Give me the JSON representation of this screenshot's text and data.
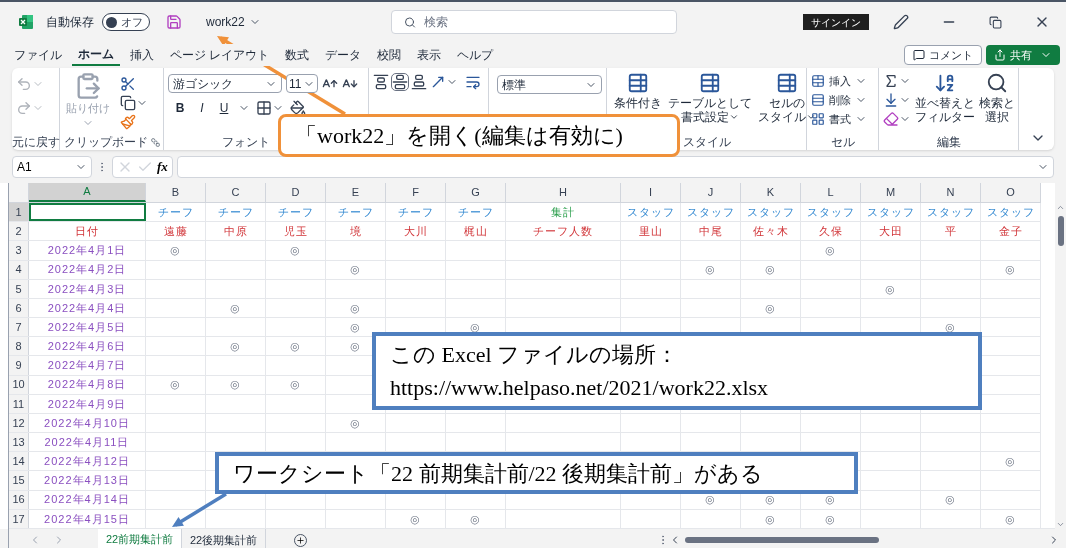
{
  "title_bar": {
    "autosave_label": "自動保存",
    "autosave_state": "オフ",
    "autosave_on": false,
    "file_name": "work22",
    "search_placeholder": "検索",
    "signin": "サインイン"
  },
  "menu_tabs": [
    {
      "label": "ファイル",
      "selected": false
    },
    {
      "label": "ホーム",
      "selected": true
    },
    {
      "label": "挿入",
      "selected": false
    },
    {
      "label": "ページ レイアウト",
      "selected": false
    },
    {
      "label": "数式",
      "selected": false
    },
    {
      "label": "データ",
      "selected": false
    },
    {
      "label": "校閲",
      "selected": false
    },
    {
      "label": "表示",
      "selected": false
    },
    {
      "label": "ヘルプ",
      "selected": false
    }
  ],
  "comment_button": "コメント",
  "share_button": "共有",
  "ribbon": {
    "undo": {
      "label": "元に戻す",
      "disabled": true
    },
    "clipboard": {
      "label": "クリップボード",
      "paste": "貼り付け",
      "paste_disabled": true
    },
    "font": {
      "label": "フォント",
      "font_name": "游ゴシック",
      "font_size": "11",
      "bold": "B",
      "italic": "I",
      "underline": "U"
    },
    "number": {
      "format": "標準"
    },
    "styles": {
      "label": "スタイル",
      "buttons": [
        {
          "lines": [
            "条件付き"
          ],
          "menu": false
        },
        {
          "lines": [
            "テーブルとして",
            "書式設定"
          ],
          "menu": true
        },
        {
          "lines": [
            "セルの",
            "スタイル"
          ],
          "menu": true
        }
      ]
    },
    "cells": {
      "label": "セル",
      "buttons": [
        {
          "kind": "insert",
          "label": "挿入"
        },
        {
          "kind": "delete",
          "label": "削除"
        },
        {
          "kind": "format",
          "label": "書式"
        }
      ]
    },
    "editing": {
      "label": "編集",
      "sort": [
        "並べ替えと",
        "フィルター"
      ],
      "find": [
        "検索と",
        "選択"
      ]
    }
  },
  "formula_bar": {
    "name_box": "A1",
    "fx": "fx"
  },
  "sheet": {
    "columns": [
      {
        "letter": "A",
        "selected": true
      },
      {
        "letter": "B",
        "selected": false
      },
      {
        "letter": "C",
        "selected": false
      },
      {
        "letter": "D",
        "selected": false
      },
      {
        "letter": "E",
        "selected": false
      },
      {
        "letter": "F",
        "selected": false
      },
      {
        "letter": "G",
        "selected": false
      },
      {
        "letter": "H",
        "selected": false
      },
      {
        "letter": "I",
        "selected": false
      },
      {
        "letter": "J",
        "selected": false
      },
      {
        "letter": "K",
        "selected": false
      },
      {
        "letter": "L",
        "selected": false
      },
      {
        "letter": "M",
        "selected": false
      },
      {
        "letter": "N",
        "selected": false
      },
      {
        "letter": "O",
        "selected": false
      }
    ],
    "rows": [
      {
        "number": "1",
        "kind": "role",
        "selected": true,
        "cells": [
          null,
          "チーフ",
          "チーフ",
          "チーフ",
          "チーフ",
          "チーフ",
          "チーフ",
          {
            "text": "集計",
            "kind": "total"
          },
          "スタッフ",
          "スタッフ",
          "スタッフ",
          "スタッフ",
          "スタッフ",
          "スタッフ",
          "スタッフ"
        ]
      },
      {
        "number": "2",
        "kind": "name",
        "selected": false,
        "cells": [
          "日付",
          "遠藤",
          "中原",
          "児玉",
          "境",
          "大川",
          "梶山",
          "チーフ人数",
          "里山",
          "中尾",
          "佐々木",
          "久保",
          "大田",
          "平",
          "金子"
        ]
      },
      {
        "number": "3",
        "kind": "entry",
        "selected": false,
        "cells": [
          "2022年4月1日",
          "◎",
          null,
          "◎",
          null,
          null,
          null,
          null,
          null,
          null,
          null,
          "◎",
          null,
          null,
          null
        ]
      },
      {
        "number": "4",
        "kind": "entry",
        "selected": false,
        "cells": [
          "2022年4月2日",
          null,
          null,
          null,
          "◎",
          null,
          null,
          null,
          null,
          "◎",
          "◎",
          null,
          null,
          null,
          "◎"
        ]
      },
      {
        "number": "5",
        "kind": "entry",
        "selected": false,
        "cells": [
          "2022年4月3日",
          null,
          null,
          null,
          null,
          null,
          null,
          null,
          null,
          null,
          null,
          null,
          "◎",
          null,
          null
        ]
      },
      {
        "number": "6",
        "kind": "entry",
        "selected": false,
        "cells": [
          "2022年4月4日",
          null,
          "◎",
          null,
          "◎",
          null,
          null,
          null,
          null,
          null,
          "◎",
          null,
          null,
          null,
          null
        ]
      },
      {
        "number": "7",
        "kind": "entry",
        "selected": false,
        "cells": [
          "2022年4月5日",
          null,
          null,
          null,
          "◎",
          null,
          "◎",
          null,
          null,
          null,
          null,
          null,
          null,
          "◎",
          null
        ]
      },
      {
        "number": "8",
        "kind": "entry",
        "selected": false,
        "cells": [
          "2022年4月6日",
          null,
          "◎",
          "◎",
          "◎",
          null,
          null,
          null,
          null,
          null,
          null,
          null,
          null,
          null,
          null
        ]
      },
      {
        "number": "9",
        "kind": "entry",
        "selected": false,
        "cells": [
          "2022年4月7日",
          null,
          null,
          null,
          null,
          null,
          null,
          null,
          null,
          null,
          null,
          null,
          null,
          null,
          null
        ]
      },
      {
        "number": "10",
        "kind": "entry",
        "selected": false,
        "cells": [
          "2022年4月8日",
          "◎",
          "◎",
          "◎",
          null,
          null,
          null,
          null,
          null,
          null,
          null,
          null,
          null,
          null,
          null
        ]
      },
      {
        "number": "11",
        "kind": "entry",
        "selected": false,
        "cells": [
          "2022年4月9日",
          null,
          null,
          null,
          null,
          null,
          null,
          null,
          null,
          null,
          null,
          null,
          null,
          null,
          null
        ]
      },
      {
        "number": "12",
        "kind": "entry",
        "selected": false,
        "cells": [
          "2022年4月10日",
          null,
          null,
          null,
          "◎",
          null,
          null,
          null,
          null,
          null,
          null,
          null,
          null,
          null,
          null
        ]
      },
      {
        "number": "13",
        "kind": "entry",
        "selected": false,
        "cells": [
          "2022年4月11日",
          null,
          null,
          null,
          null,
          null,
          null,
          null,
          null,
          null,
          null,
          null,
          null,
          null,
          null
        ]
      },
      {
        "number": "14",
        "kind": "entry",
        "selected": false,
        "cells": [
          "2022年4月12日",
          null,
          null,
          null,
          null,
          null,
          null,
          null,
          null,
          null,
          null,
          null,
          null,
          null,
          "◎"
        ]
      },
      {
        "number": "15",
        "kind": "entry",
        "selected": false,
        "cells": [
          "2022年4月13日",
          null,
          null,
          null,
          null,
          null,
          null,
          null,
          null,
          null,
          null,
          null,
          null,
          null,
          null
        ]
      },
      {
        "number": "16",
        "kind": "entry",
        "selected": false,
        "cells": [
          "2022年4月14日",
          null,
          null,
          null,
          null,
          null,
          null,
          null,
          null,
          "◎",
          "◎",
          "◎",
          null,
          "◎",
          null
        ]
      },
      {
        "number": "17",
        "kind": "entry",
        "selected": false,
        "cells": [
          "2022年4月15日",
          null,
          null,
          null,
          null,
          "◎",
          "◎",
          null,
          null,
          null,
          "◎",
          "◎",
          null,
          null,
          "◎"
        ]
      }
    ]
  },
  "sheet_tabs": [
    {
      "label": "22前期集計前",
      "selected": true
    },
    {
      "label": "22後期集計前",
      "selected": false
    }
  ],
  "callouts": [
    {
      "kind": "orange",
      "lines": [
        "「work22」を開く(編集は有効に)"
      ]
    },
    {
      "kind": "blue",
      "lines": [
        "この Excel ファイルの場所：",
        "https://www.helpaso.net/2021/work22.xlsx"
      ]
    },
    {
      "kind": "blue-arrow",
      "lines": [
        "ワークシート「22 前期集計前/22 後期集計前」がある"
      ]
    }
  ]
}
